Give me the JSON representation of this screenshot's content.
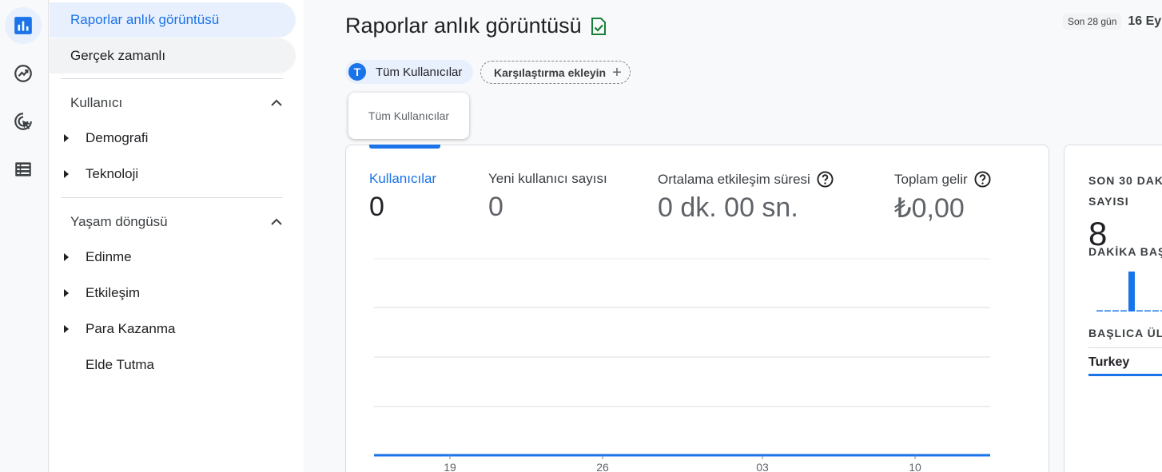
{
  "rail": {
    "items": [
      {
        "name": "reports-icon",
        "active": true
      },
      {
        "name": "explore-icon",
        "active": false
      },
      {
        "name": "advertising-icon",
        "active": false
      },
      {
        "name": "configure-icon",
        "active": false
      }
    ]
  },
  "nav": {
    "snapshot": "Raporlar anlık görüntüsü",
    "realtime": "Gerçek zamanlı",
    "section_user": "Kullanıcı",
    "demographics": "Demografi",
    "technology": "Teknoloji",
    "section_lifecycle": "Yaşam döngüsü",
    "acquisition": "Edinme",
    "engagement": "Etkileşim",
    "monetization": "Para Kazanma",
    "retention": "Elde Tutma"
  },
  "header": {
    "title": "Raporlar anlık görüntüsü",
    "date_chip": "Son 28 gün",
    "date_text": "16 Ey"
  },
  "segments": {
    "avatar_letter": "T",
    "all_users": "Tüm Kullanıcılar",
    "add_comparison": "Karşılaştırma ekleyin",
    "tooltip": "Tüm Kullanıcılar"
  },
  "metrics": [
    {
      "label": "Kullanıcılar",
      "value": "0",
      "active": true,
      "help": false
    },
    {
      "label": "Yeni kullanıcı sayısı",
      "value": "0",
      "active": false,
      "help": false
    },
    {
      "label": "Ortalama etkileşim süresi",
      "value": "0 dk. 00 sn.",
      "active": false,
      "help": true
    },
    {
      "label": "Toplam gelir",
      "value": "₺0,00",
      "active": false,
      "help": true
    }
  ],
  "chart_data": {
    "type": "line",
    "x_ticks": [
      "19",
      "26",
      "03",
      "10"
    ],
    "series": [
      {
        "values": [
          0,
          0,
          0,
          0
        ]
      }
    ],
    "grid": true
  },
  "realtime": {
    "title_line1": "SON 30 DAKİ",
    "title_line2": "SAYISI",
    "value": "8",
    "per_minute_label": "DAKİKA BAŞ",
    "top_countries_label": "BAŞLICA ÜL",
    "country": "Turkey",
    "minute_bars": [
      0,
      0,
      0,
      0,
      8,
      0,
      0,
      0,
      0,
      0
    ]
  },
  "colors": {
    "accent": "#1a73e8",
    "green_check": "#188038",
    "active_bg": "#e8f0fe"
  }
}
